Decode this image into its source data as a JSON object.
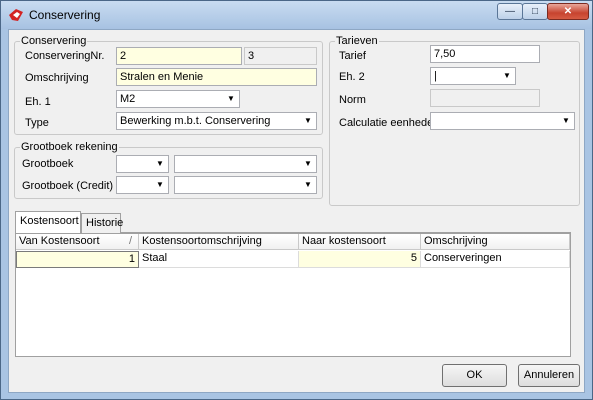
{
  "window": {
    "title": "Conservering",
    "min_glyph": "—",
    "max_glyph": "□",
    "close_glyph": "✕"
  },
  "conservering": {
    "group_title": "Conservering",
    "nr_label": "ConserveringNr.",
    "nr_value": "2",
    "nr_extra": "3",
    "omschrijving_label": "Omschrijving",
    "omschrijving_value": "Stralen en Menie",
    "eh1_label": "Eh. 1",
    "eh1_value": "M2",
    "type_label": "Type",
    "type_value": "Bewerking m.b.t. Conservering"
  },
  "grootboek": {
    "group_title": "Grootboek rekening",
    "grootboek_label": "Grootboek",
    "credit_label": "Grootboek (Credit)"
  },
  "tarieven": {
    "group_title": "Tarieven",
    "tarief_label": "Tarief",
    "tarief_value": "7,50",
    "eh2_label": "Eh. 2",
    "eh2_value": "|",
    "norm_label": "Norm",
    "calc_label": "Calculatie eenheden"
  },
  "tabs": [
    {
      "label": "Kostensoort"
    },
    {
      "label": "Historie"
    }
  ],
  "grid": {
    "columns": [
      "Van Kostensoort",
      "Kostensoortomschrijving",
      "Naar kostensoort",
      "Omschrijving"
    ],
    "sort_glyph": "/",
    "rows": [
      {
        "van": "1",
        "omschrijving_van": "Staal",
        "naar": "5",
        "omschrijving_naar": "Conserveringen"
      }
    ]
  },
  "buttons": {
    "ok": "OK",
    "cancel": "Annuleren"
  },
  "icons": {
    "app": "app-logo-icon",
    "dropdown": "chevron-down-icon"
  }
}
